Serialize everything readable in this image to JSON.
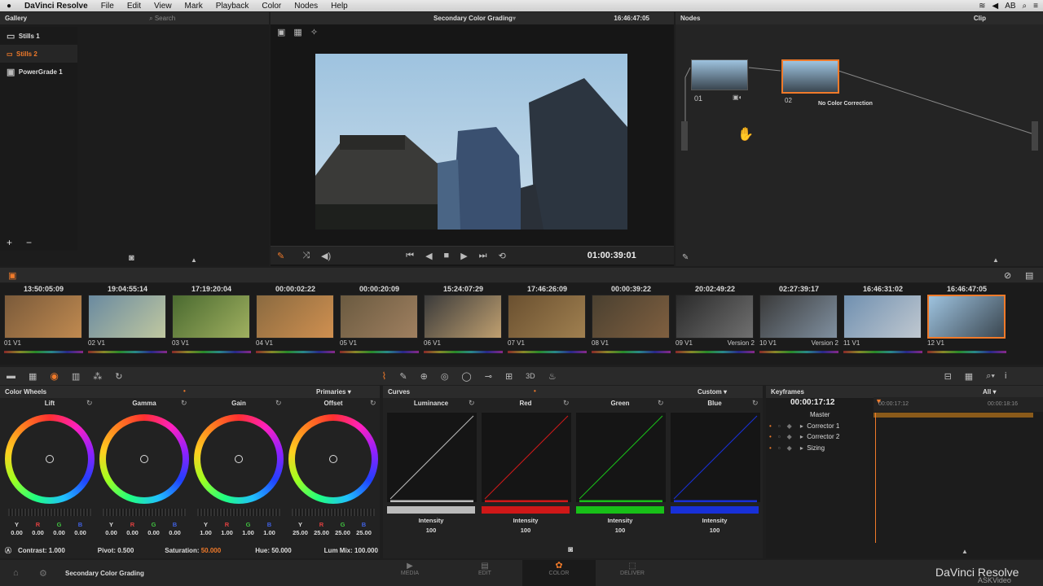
{
  "menubar": {
    "app": "DaVinci Resolve",
    "items": [
      "File",
      "Edit",
      "View",
      "Mark",
      "Playback",
      "Color",
      "Nodes",
      "Help"
    ],
    "status": "AB"
  },
  "gallery": {
    "title": "Gallery",
    "search_placeholder": "Search",
    "items": [
      "Stills 1",
      "Stills 2",
      "PowerGrade 1"
    ]
  },
  "viewer": {
    "title": "Secondary Color Grading",
    "timecode_top": "16:46:47:05",
    "timecode": "01:00:39:01"
  },
  "nodes": {
    "title": "Nodes",
    "clip_label": "Clip",
    "node1_label": "01",
    "node2_label": "02",
    "node2_caption": "No Color Correction"
  },
  "timeline": {
    "clips": [
      {
        "tc": "13:50:05:09",
        "num": "01",
        "track": "V1",
        "version": ""
      },
      {
        "tc": "19:04:55:14",
        "num": "02",
        "track": "V1",
        "version": ""
      },
      {
        "tc": "17:19:20:04",
        "num": "03",
        "track": "V1",
        "version": ""
      },
      {
        "tc": "00:00:02:22",
        "num": "04",
        "track": "V1",
        "version": ""
      },
      {
        "tc": "00:00:20:09",
        "num": "05",
        "track": "V1",
        "version": ""
      },
      {
        "tc": "15:24:07:29",
        "num": "06",
        "track": "V1",
        "version": ""
      },
      {
        "tc": "17:46:26:09",
        "num": "07",
        "track": "V1",
        "version": ""
      },
      {
        "tc": "00:00:39:22",
        "num": "08",
        "track": "V1",
        "version": ""
      },
      {
        "tc": "20:02:49:22",
        "num": "09",
        "track": "V1",
        "version": "Version 2"
      },
      {
        "tc": "02:27:39:17",
        "num": "10",
        "track": "V1",
        "version": "Version 2"
      },
      {
        "tc": "16:46:31:02",
        "num": "11",
        "track": "V1",
        "version": ""
      },
      {
        "tc": "16:46:47:05",
        "num": "12",
        "track": "V1",
        "version": ""
      }
    ]
  },
  "colorwheels": {
    "title": "Color Wheels",
    "mode": "Primaries",
    "wheels": [
      {
        "name": "Lift",
        "vals": [
          "0.00",
          "0.00",
          "0.00",
          "0.00"
        ]
      },
      {
        "name": "Gamma",
        "vals": [
          "0.00",
          "0.00",
          "0.00",
          "0.00"
        ]
      },
      {
        "name": "Gain",
        "vals": [
          "1.00",
          "1.00",
          "1.00",
          "1.00"
        ]
      },
      {
        "name": "Offset",
        "vals": [
          "25.00",
          "25.00",
          "25.00",
          "25.00"
        ]
      }
    ],
    "channel_labels": [
      "Y",
      "R",
      "G",
      "B"
    ],
    "footer": {
      "contrast": "Contrast: 1.000",
      "pivot": "Pivot: 0.500",
      "saturation_label": "Saturation:",
      "saturation_value": "50.000",
      "hue": "Hue: 50.000",
      "lummix": "Lum Mix: 100.000"
    }
  },
  "curves": {
    "title": "Curves",
    "mode": "Custom",
    "channels": [
      {
        "name": "Luminance",
        "intensity_label": "Intensity",
        "intensity": "100",
        "color": "#bbbbbb"
      },
      {
        "name": "Red",
        "intensity_label": "Intensity",
        "intensity": "100",
        "color": "#d01818"
      },
      {
        "name": "Green",
        "intensity_label": "Intensity",
        "intensity": "100",
        "color": "#18c018"
      },
      {
        "name": "Blue",
        "intensity_label": "Intensity",
        "intensity": "100",
        "color": "#1830d8"
      }
    ]
  },
  "keyframes": {
    "title": "Keyframes",
    "filter": "All",
    "timecode": "00:00:17:12",
    "ruler_start": "00:00:17:12",
    "ruler_end": "00:00:18:16",
    "tracks": [
      "Master",
      "Corrector 1",
      "Corrector 2",
      "Sizing"
    ]
  },
  "footer": {
    "project": "Secondary Color Grading",
    "tabs": [
      "MEDIA",
      "EDIT",
      "COLOR",
      "DELIVER"
    ],
    "brand": "DaVinci Resolve",
    "watermark": "ASKVideo"
  },
  "colors": {
    "accent": "#f07a2a",
    "panel": "#1c1c1c",
    "header": "#2b2b2b"
  }
}
